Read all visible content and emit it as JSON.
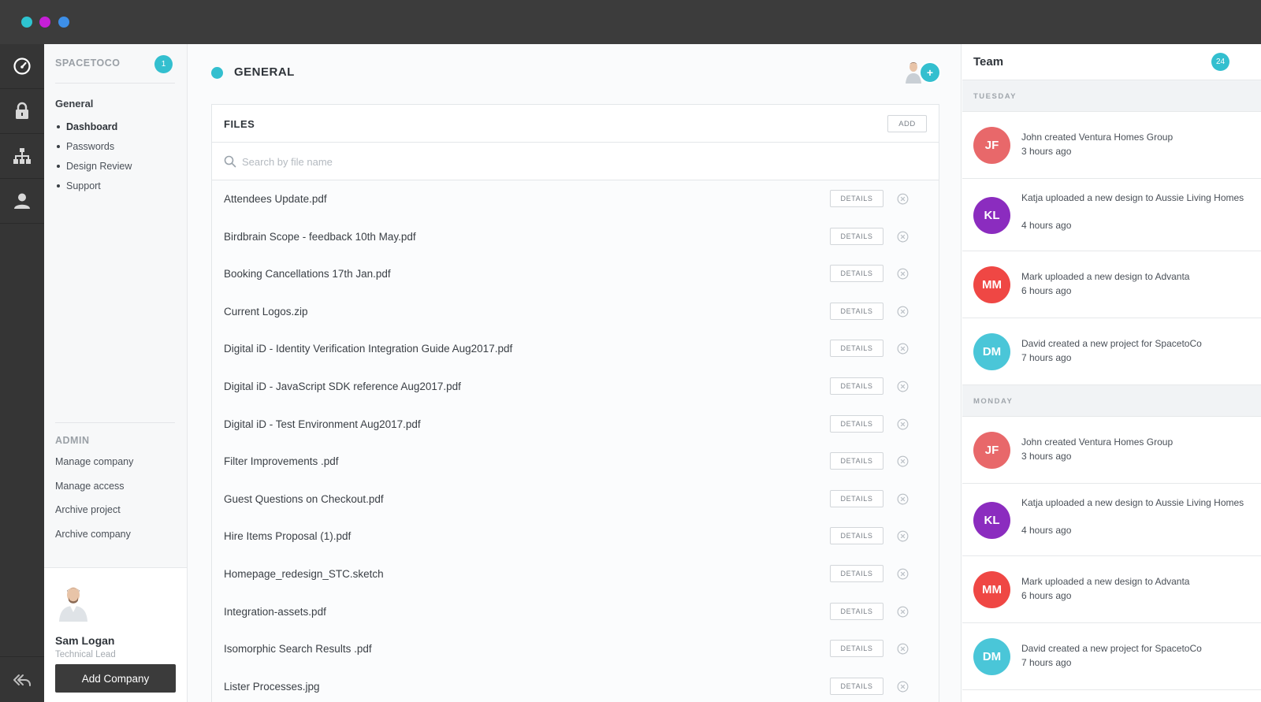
{
  "window": {
    "traffic_lights": [
      "#2ec4d0",
      "#c61fd6",
      "#3d8fe8"
    ]
  },
  "rail": {
    "items": [
      "dashboard-icon",
      "lock-icon",
      "org-chart-icon",
      "user-icon"
    ],
    "back_icon": "reply-back-icon"
  },
  "sidebar": {
    "company": "SPACETOCO",
    "company_badge": "1",
    "section_heading": "General",
    "items": [
      {
        "label": "Dashboard"
      },
      {
        "label": "Passwords"
      },
      {
        "label": "Design Review"
      },
      {
        "label": "Support"
      }
    ],
    "admin_heading": "ADMIN",
    "admin_items": [
      {
        "label": "Manage company"
      },
      {
        "label": "Manage access"
      },
      {
        "label": "Archive project"
      },
      {
        "label": "Archive company"
      }
    ],
    "user": {
      "name": "Sam Logan",
      "role": "Technical Lead"
    },
    "add_company_label": "Add Company"
  },
  "main": {
    "title": "GENERAL",
    "plus_label": "+",
    "files": {
      "title": "FILES",
      "add_label": "ADD",
      "search_placeholder": "Search by file name",
      "details_label": "DETAILS",
      "rows": [
        {
          "name": "Attendees Update.pdf"
        },
        {
          "name": "Birdbrain Scope - feedback 10th May.pdf"
        },
        {
          "name": "Booking Cancellations 17th Jan.pdf"
        },
        {
          "name": "Current Logos.zip"
        },
        {
          "name": "Digital iD - Identity Verification Integration Guide Aug2017.pdf"
        },
        {
          "name": "Digital iD - JavaScript SDK reference Aug2017.pdf"
        },
        {
          "name": "Digital iD - Test Environment Aug2017.pdf"
        },
        {
          "name": "Filter Improvements .pdf"
        },
        {
          "name": "Guest Questions on Checkout.pdf"
        },
        {
          "name": "Hire Items Proposal (1).pdf"
        },
        {
          "name": "Homepage_redesign_STC.sketch"
        },
        {
          "name": "Integration-assets.pdf"
        },
        {
          "name": "Isomorphic Search Results .pdf"
        },
        {
          "name": "Lister Processes.jpg"
        }
      ]
    }
  },
  "team": {
    "title": "Team",
    "badge": "24",
    "days": [
      {
        "label": "TUESDAY",
        "activities": [
          {
            "initials": "JF",
            "color": "#e8686a",
            "text": "John created Ventura Homes Group",
            "time": "3 hours ago"
          },
          {
            "initials": "KL",
            "color": "#8b2cbf",
            "text": "Katja uploaded a new design to Aussie Living Homes",
            "time": "4 hours ago"
          },
          {
            "initials": "MM",
            "color": "#ef4744",
            "text": "Mark uploaded a new design to Advanta",
            "time": "6 hours ago"
          },
          {
            "initials": "DM",
            "color": "#4ac6d8",
            "text": "David created a new project for SpacetoCo",
            "time": "7 hours ago"
          }
        ]
      },
      {
        "label": "MONDAY",
        "activities": [
          {
            "initials": "JF",
            "color": "#e8686a",
            "text": "John created Ventura Homes Group",
            "time": "3 hours ago"
          },
          {
            "initials": "KL",
            "color": "#8b2cbf",
            "text": "Katja uploaded a new design to Aussie Living Homes",
            "time": "4 hours ago"
          },
          {
            "initials": "MM",
            "color": "#ef4744",
            "text": "Mark uploaded a new design to Advanta",
            "time": "6 hours ago"
          },
          {
            "initials": "DM",
            "color": "#4ac6d8",
            "text": "David created a new project for SpacetoCo",
            "time": "7 hours ago"
          }
        ]
      }
    ]
  }
}
